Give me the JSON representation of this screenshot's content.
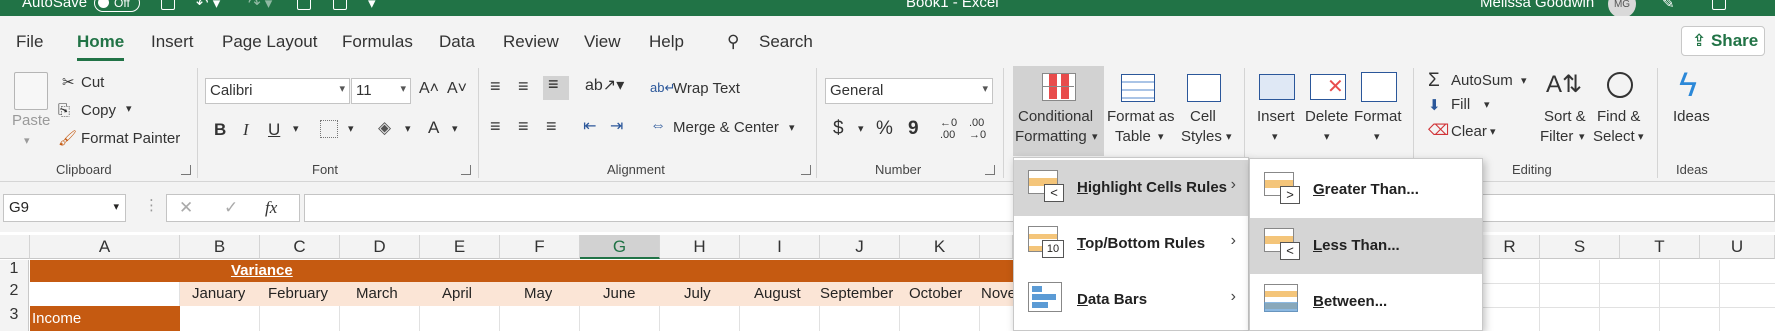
{
  "titlebar": {
    "autosave_label": "AutoSave",
    "autosave_state": "Off",
    "doc_title": "Book1 - Excel",
    "user_name": "Melissa Goodwin",
    "user_initials": "MG"
  },
  "tabs": [
    "File",
    "Home",
    "Insert",
    "Page Layout",
    "Formulas",
    "Data",
    "Review",
    "View",
    "Help"
  ],
  "search_label": "Search",
  "share_label": "Share",
  "ribbon": {
    "clipboard": {
      "paste": "Paste",
      "cut": "Cut",
      "copy": "Copy",
      "format_painter": "Format Painter",
      "label": "Clipboard"
    },
    "font": {
      "name": "Calibri",
      "size": "11",
      "bold": "B",
      "italic": "I",
      "underline": "U",
      "font_color": "A",
      "label": "Font"
    },
    "alignment": {
      "wrap_text": "Wrap Text",
      "merge_center": "Merge & Center",
      "label": "Alignment"
    },
    "number": {
      "format": "General",
      "currency": "$",
      "percent": "%",
      "comma": "9",
      "label": "Number"
    },
    "styles": {
      "conditional_formatting": [
        "Conditional",
        "Formatting"
      ],
      "format_as_table": [
        "Format as",
        "Table"
      ],
      "cell_styles": [
        "Cell",
        "Styles"
      ]
    },
    "cells": {
      "insert": "Insert",
      "delete": "Delete",
      "format": "Format"
    },
    "editing": {
      "autosum": "AutoSum",
      "fill": "Fill",
      "clear": "Clear",
      "sort_filter": [
        "Sort &",
        "Filter"
      ],
      "find_select": [
        "Find &",
        "Select"
      ],
      "label": "Editing"
    },
    "ideas": {
      "button": "Ideas",
      "label": "Ideas"
    }
  },
  "formula_bar": {
    "name_box": "G9",
    "fx": "fx",
    "content": ""
  },
  "columns": [
    "A",
    "B",
    "C",
    "D",
    "E",
    "F",
    "G",
    "H",
    "I",
    "J",
    "K",
    "R",
    "S",
    "T",
    "U"
  ],
  "selected_column": "G",
  "rows": [
    "1",
    "2",
    "3"
  ],
  "sheet": {
    "variance_title": "Variance",
    "months": [
      "January",
      "February",
      "March",
      "April",
      "May",
      "June",
      "July",
      "August",
      "September",
      "October",
      "Nove"
    ],
    "income_label": "Income"
  },
  "cf_menu": {
    "items": [
      {
        "label": "Highlight Cells Rules",
        "underline": "H",
        "rest": "ighlight Cells Rules",
        "highlighted": true
      },
      {
        "label": "Top/Bottom Rules",
        "underline": "T",
        "rest": "op/Bottom Rules",
        "highlighted": false
      },
      {
        "label": "Data Bars",
        "underline": "D",
        "rest": "ata Bars",
        "highlighted": false
      }
    ]
  },
  "cf_submenu": {
    "items": [
      {
        "label": "Greater Than...",
        "underline": "G",
        "rest": "reater Than...",
        "highlighted": false
      },
      {
        "label": "Less Than...",
        "underline": "L",
        "rest": "ess Than...",
        "highlighted": true
      },
      {
        "label": "Between...",
        "underline": "B",
        "rest": "etween...",
        "highlighted": false
      }
    ]
  },
  "colors": {
    "excel_green": "#217346",
    "header_orange": "#c55a11",
    "month_row": "#fbe5d6"
  }
}
